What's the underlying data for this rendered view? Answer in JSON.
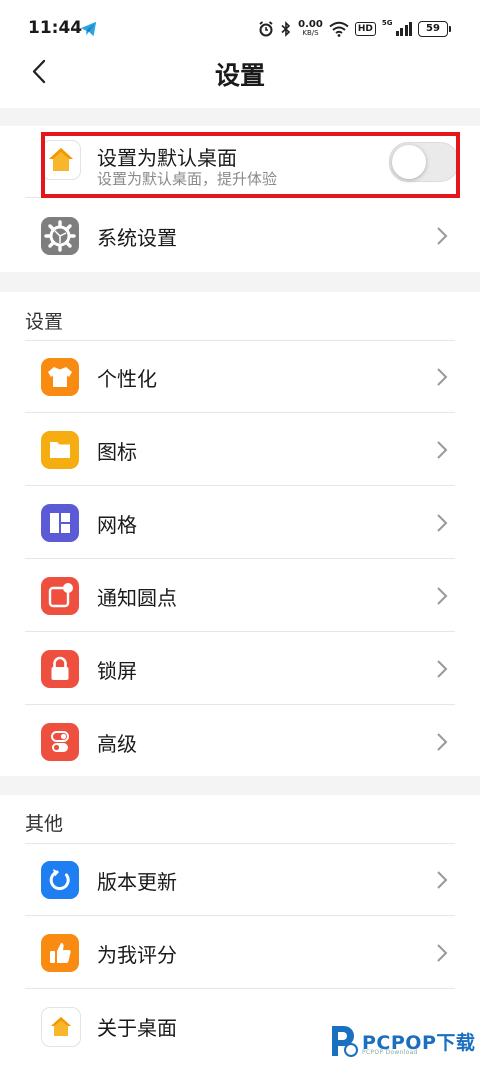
{
  "status_bar": {
    "time": "11:44",
    "speed_value": "0.00",
    "speed_unit": "KB/S",
    "network_type": "5G",
    "hd_badge": "HD",
    "battery": "59"
  },
  "header": {
    "title": "设置"
  },
  "default_launcher": {
    "title": "设置为默认桌面",
    "subtitle": "设置为默认桌面，提升体验",
    "enabled": false
  },
  "system_settings": {
    "label": "系统设置"
  },
  "settings_section": {
    "title": "设置",
    "items": [
      {
        "label": "个性化",
        "icon": "tshirt-icon",
        "color": "#f98a12"
      },
      {
        "label": "图标",
        "icon": "folder-icon",
        "color": "#f6ad11"
      },
      {
        "label": "网格",
        "icon": "grid-icon",
        "color": "#5b5bd6"
      },
      {
        "label": "通知圆点",
        "icon": "notification-dot-icon",
        "color": "#ef4f3f"
      },
      {
        "label": "锁屏",
        "icon": "lock-icon",
        "color": "#ef4f3f"
      },
      {
        "label": "高级",
        "icon": "toggles-icon",
        "color": "#ef4f3f"
      }
    ]
  },
  "other_section": {
    "title": "其他",
    "items": [
      {
        "label": "版本更新",
        "icon": "refresh-icon",
        "color": "#1e7ef2"
      },
      {
        "label": "为我评分",
        "icon": "thumbs-up-icon",
        "color": "#f98a12"
      },
      {
        "label": "关于桌面",
        "icon": "home-icon",
        "color": "#ffffff"
      }
    ]
  },
  "watermark": {
    "brand": "PCPOP下载",
    "sub": "PCPOP Download"
  }
}
